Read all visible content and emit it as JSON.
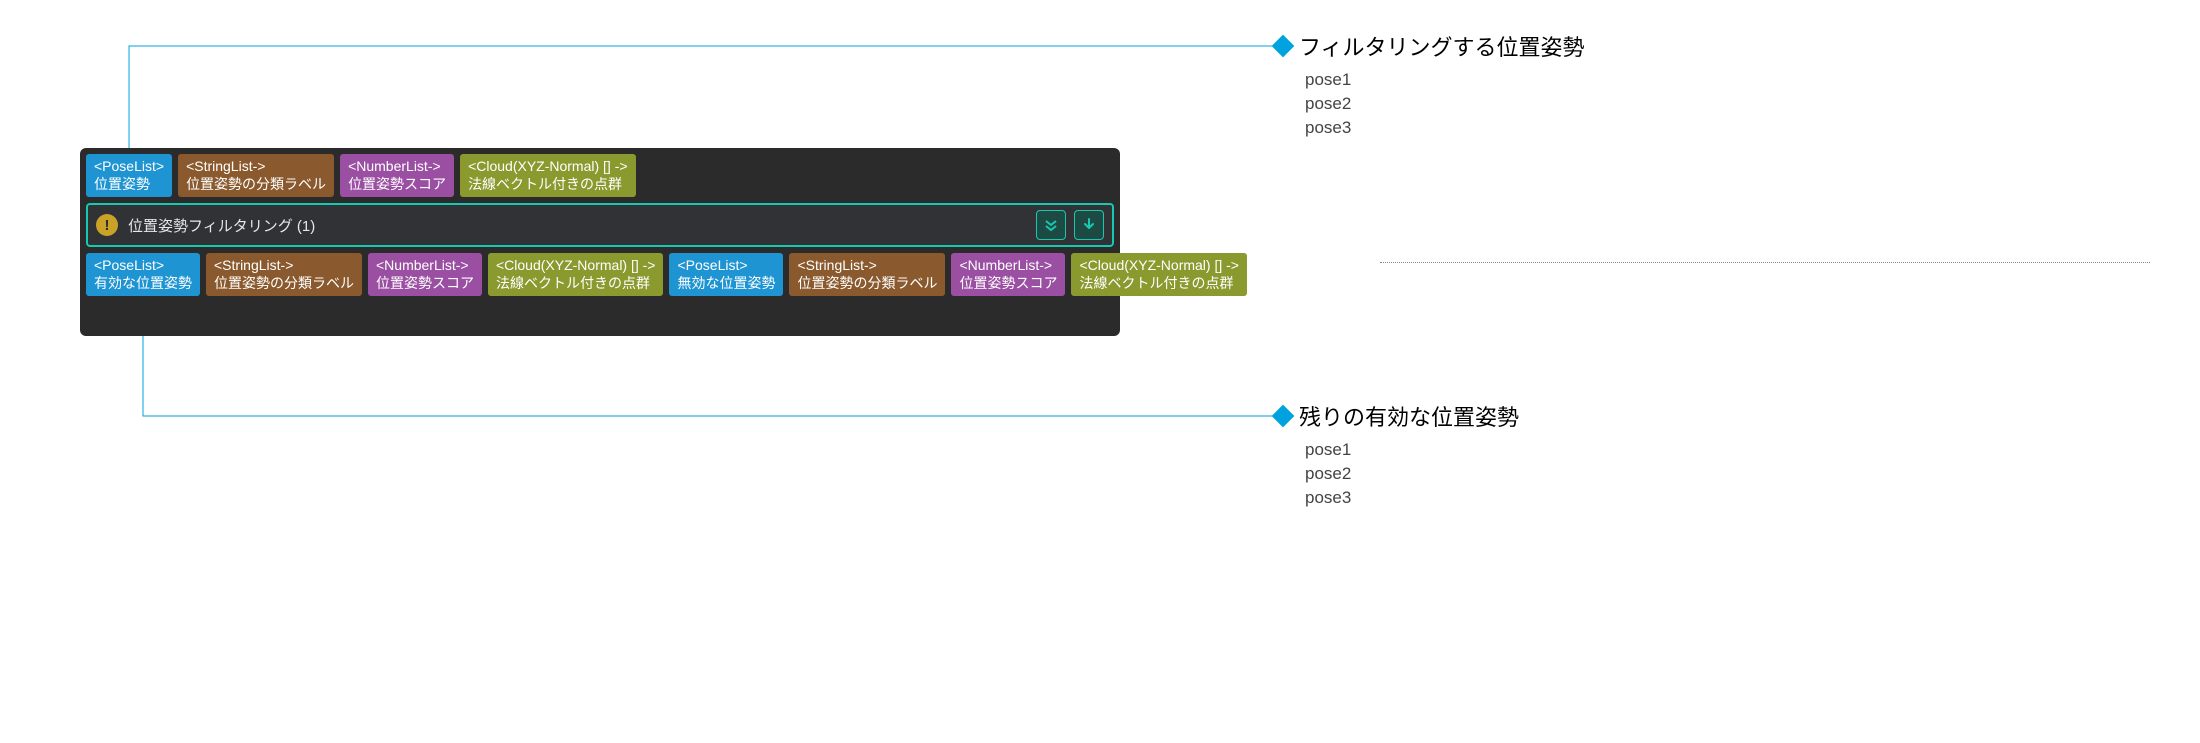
{
  "node": {
    "title": "位置姿勢フィルタリング (1)",
    "inputs": [
      {
        "type": "<PoseList>",
        "label": "位置姿勢",
        "color": "blue"
      },
      {
        "type": "<StringList->",
        "label": "位置姿勢の分類ラベル",
        "color": "brown"
      },
      {
        "type": "<NumberList->",
        "label": "位置姿勢スコア",
        "color": "purple"
      },
      {
        "type": "<Cloud(XYZ-Normal) [] ->",
        "label": "法線ベクトル付きの点群",
        "color": "olive"
      }
    ],
    "outputs": [
      {
        "type": "<PoseList>",
        "label": "有効な位置姿勢",
        "color": "blue"
      },
      {
        "type": "<StringList->",
        "label": "位置姿勢の分類ラベル",
        "color": "brown"
      },
      {
        "type": "<NumberList->",
        "label": "位置姿勢スコア",
        "color": "purple"
      },
      {
        "type": "<Cloud(XYZ-Normal) [] ->",
        "label": "法線ベクトル付きの点群",
        "color": "olive"
      },
      {
        "type": "<PoseList>",
        "label": "無効な位置姿勢",
        "color": "blue"
      },
      {
        "type": "<StringList->",
        "label": "位置姿勢の分類ラベル",
        "color": "brown"
      },
      {
        "type": "<NumberList->",
        "label": "位置姿勢スコア",
        "color": "purple"
      },
      {
        "type": "<Cloud(XYZ-Normal) [] ->",
        "label": "法線ベクトル付きの点群",
        "color": "olive"
      }
    ]
  },
  "callouts": {
    "input": {
      "heading": "フィルタリングする位置姿勢",
      "poses": [
        "pose1",
        "pose2",
        "pose3"
      ]
    },
    "output": {
      "heading": "残りの有効な位置姿勢",
      "poses": [
        "pose1",
        "pose2",
        "pose3"
      ]
    }
  },
  "colors": {
    "accent": "#16c9b0",
    "connector": "#00a3e0"
  }
}
